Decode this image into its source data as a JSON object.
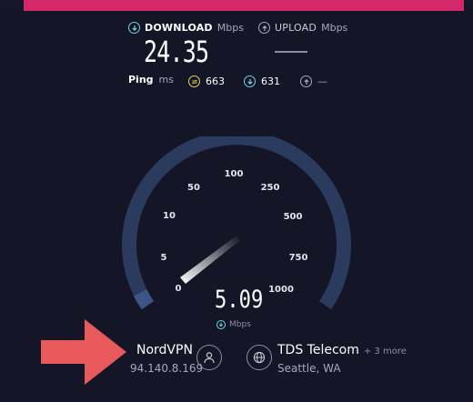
{
  "download": {
    "label": "DOWNLOAD",
    "unit": "Mbps",
    "value": "24.35"
  },
  "upload": {
    "label": "UPLOAD",
    "unit": "Mbps",
    "value": "—"
  },
  "ping": {
    "label": "Ping",
    "unit": "ms",
    "jitter": "663",
    "download": "631",
    "upload": "—"
  },
  "gauge": {
    "ticks": [
      "0",
      "5",
      "10",
      "50",
      "100",
      "250",
      "500",
      "750",
      "1000"
    ],
    "current_value": "5.09",
    "unit": "Mbps"
  },
  "server": {
    "provider": "NordVPN",
    "ip": "94.140.8.169"
  },
  "isp": {
    "name": "TDS Telecom",
    "more": "+ 3 more",
    "location": "Seattle, WA"
  },
  "colors": {
    "background": "#141526",
    "accent_bar": "#d4286a",
    "download_accent": "#6fd3e6",
    "jitter_accent": "#e3d258",
    "gauge_track": "#2a3b5e",
    "arrow": "#e8595b"
  }
}
